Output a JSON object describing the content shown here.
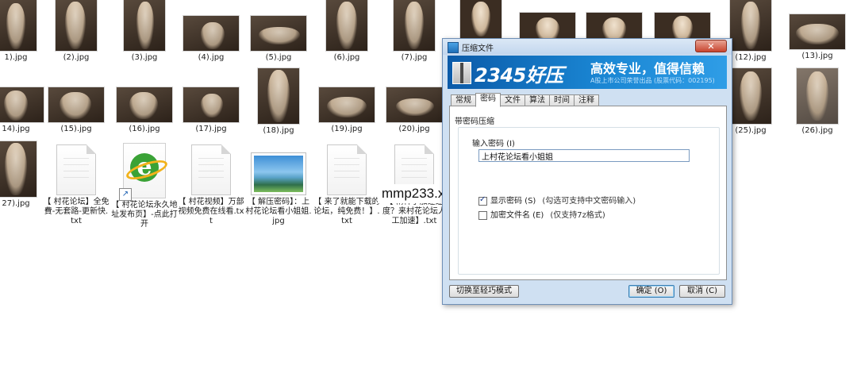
{
  "explorer": {
    "row1": [
      {
        "name": "1).jpg"
      },
      {
        "name": "(2).jpg"
      },
      {
        "name": "(3).jpg"
      },
      {
        "name": "(4).jpg"
      },
      {
        "name": "(5).jpg"
      },
      {
        "name": "(6).jpg"
      },
      {
        "name": "(7).jpg"
      },
      {
        "name": "(12).jpg"
      },
      {
        "name": "(13).jpg"
      }
    ],
    "row2": [
      {
        "name": "14).jpg"
      },
      {
        "name": "(15).jpg"
      },
      {
        "name": "(16).jpg"
      },
      {
        "name": "(17).jpg"
      },
      {
        "name": "(18).jpg"
      },
      {
        "name": "(19).jpg"
      },
      {
        "name": "(20).jpg"
      },
      {
        "name": "(25).jpg"
      },
      {
        "name": "(26).jpg"
      }
    ],
    "row3": [
      {
        "name": "27).jpg"
      },
      {
        "name": "【 村花论坛】全免費-无套路-更新快.txt"
      },
      {
        "name": "【 村花论坛永久地址发布页】-点此打开"
      },
      {
        "name": "【 村花视频】万部视频免费在线看.txt"
      },
      {
        "name": "【 解压密码】：上村花论坛看小姐姐.jpg"
      },
      {
        "name": "【 来了就能下载的论坛，纯免费！】.txt"
      },
      {
        "name": "【 精神于加速速度？来村花论坛人工加速】.txt"
      }
    ],
    "watermark": "mmp233.xyz"
  },
  "dialog": {
    "title": "压缩文件",
    "close_label": "✕",
    "banner": {
      "logo": "2345好压",
      "slogan": "高效专业，值得信赖",
      "sub": "A股上市公司荣誉出品 (股票代码：002195)"
    },
    "tabs": [
      "常规",
      "密码",
      "文件",
      "算法",
      "时间",
      "注释"
    ],
    "active_tab": "密码",
    "group_label": "带密码压缩",
    "password_label": "输入密码 (I)",
    "password_value": "上村花论坛看小姐姐",
    "show_password": {
      "label": "显示密码 (S)",
      "hint": "(勾选可支持中文密码输入)",
      "checked": true
    },
    "encrypt_names": {
      "label": "加密文件名 (E)",
      "hint": "(仅支持7z格式)",
      "checked": false
    },
    "buttons": {
      "switch_mode": "切换至轻巧模式",
      "ok": "确定 (O)",
      "cancel": "取消 (C)"
    }
  }
}
